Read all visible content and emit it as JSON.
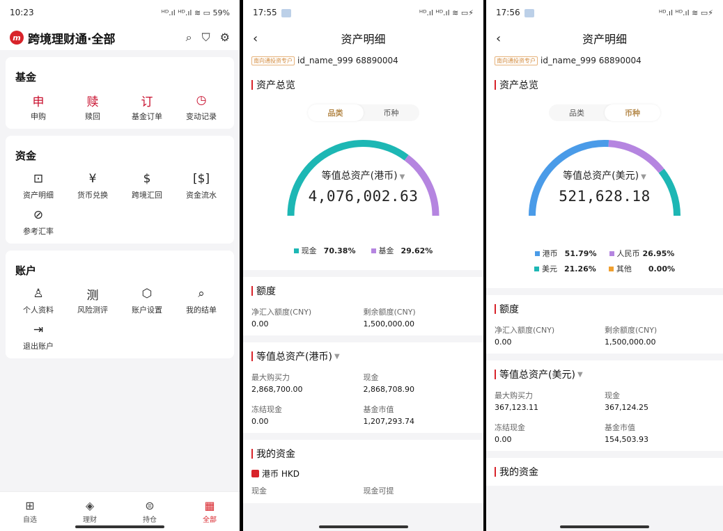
{
  "p1": {
    "status": {
      "time": "10:23",
      "right": "ᴴᴰ.ıl ᴴᴰ.ıl ≋ ▭ 59%"
    },
    "header": {
      "title": "跨境理财通·全部",
      "logo": "m"
    },
    "fund": {
      "title": "基金",
      "items": [
        {
          "glyph": "申",
          "label": "申购"
        },
        {
          "glyph": "赎",
          "label": "赎回"
        },
        {
          "glyph": "订",
          "label": "基金订单"
        },
        {
          "glyph": "◷",
          "label": "变动记录"
        }
      ]
    },
    "cash": {
      "title": "资金",
      "items": [
        {
          "glyph": "⊡",
          "label": "资产明细"
        },
        {
          "glyph": "¥",
          "label": "货币兑换"
        },
        {
          "glyph": "$",
          "label": "跨境汇回"
        },
        {
          "glyph": "[$]",
          "label": "资金流水"
        },
        {
          "glyph": "⊘",
          "label": "参考汇率"
        }
      ]
    },
    "account": {
      "title": "账户",
      "items": [
        {
          "glyph": "♙",
          "label": "个人资料"
        },
        {
          "glyph": "测",
          "label": "风险测评"
        },
        {
          "glyph": "⬡",
          "label": "账户设置"
        },
        {
          "glyph": "⌕",
          "label": "我的结单"
        },
        {
          "glyph": "⇥",
          "label": "退出账户"
        }
      ]
    },
    "tabs": [
      {
        "icon": "⊞",
        "label": "自选"
      },
      {
        "icon": "◈",
        "label": "理财"
      },
      {
        "icon": "⊜",
        "label": "持仓"
      },
      {
        "icon": "▦",
        "label": "全部"
      }
    ]
  },
  "p2": {
    "status": {
      "time": "17:55",
      "right": "ᴴᴰ.ıl ᴴᴰ.ıl ≋ ▭⚡"
    },
    "nav": {
      "title": "资产明细",
      "back": "‹"
    },
    "acct": {
      "badge": "南向通投资专户",
      "id": "id_name_999 68890004"
    },
    "overview": {
      "title": "资产总览",
      "toggle": [
        "品类",
        "币种"
      ],
      "gauge_label": "等值总资产(港币)",
      "gauge_value": "4,076,002.63",
      "segments": [
        {
          "name": "现金",
          "pct": "70.38%",
          "frac": 0.7038,
          "color": "#1db7b4"
        },
        {
          "name": "基金",
          "pct": "29.62%",
          "frac": 0.2962,
          "color": "#b585e0"
        }
      ]
    },
    "quota": {
      "title": "额度",
      "items": [
        {
          "k": "净汇入额度(CNY)",
          "v": "0.00"
        },
        {
          "k": "剩余额度(CNY)",
          "v": "1,500,000.00"
        }
      ]
    },
    "equiv": {
      "title": "等值总资产(港币)",
      "items": [
        {
          "k": "最大购买力",
          "v": "2,868,700.00"
        },
        {
          "k": "现金",
          "v": "2,868,708.90"
        },
        {
          "k": "冻结现金",
          "v": "0.00"
        },
        {
          "k": "基金市值",
          "v": "1,207,293.74"
        }
      ]
    },
    "my": {
      "title": "我的资金",
      "currency": "港币 HKD",
      "sub1": "现金",
      "sub2": "现金可提"
    }
  },
  "p3": {
    "status": {
      "time": "17:56",
      "right": "ᴴᴰ.ıl ᴴᴰ.ıl ≋ ▭⚡"
    },
    "nav": {
      "title": "资产明细",
      "back": "‹"
    },
    "acct": {
      "badge": "南向通投资专户",
      "id": "id_name_999 68890004"
    },
    "overview": {
      "title": "资产总览",
      "toggle": [
        "品类",
        "币种"
      ],
      "gauge_label": "等值总资产(美元)",
      "gauge_value": "521,628.18",
      "segments": [
        {
          "name": "港币",
          "pct": "51.79%",
          "frac": 0.5179,
          "color": "#4a9be8"
        },
        {
          "name": "人民币",
          "pct": "26.95%",
          "frac": 0.2695,
          "color": "#b585e0"
        },
        {
          "name": "美元",
          "pct": "21.26%",
          "frac": 0.2126,
          "color": "#1db7b4"
        },
        {
          "name": "其他",
          "pct": "0.00%",
          "frac": 0.0,
          "color": "#f0a030"
        }
      ]
    },
    "quota": {
      "title": "额度",
      "items": [
        {
          "k": "净汇入额度(CNY)",
          "v": "0.00"
        },
        {
          "k": "剩余额度(CNY)",
          "v": "1,500,000.00"
        }
      ]
    },
    "equiv": {
      "title": "等值总资产(美元)",
      "items": [
        {
          "k": "最大购买力",
          "v": "367,123.11"
        },
        {
          "k": "现金",
          "v": "367,124.25"
        },
        {
          "k": "冻结现金",
          "v": "0.00"
        },
        {
          "k": "基金市值",
          "v": "154,503.93"
        }
      ]
    },
    "my": {
      "title": "我的资金"
    }
  }
}
